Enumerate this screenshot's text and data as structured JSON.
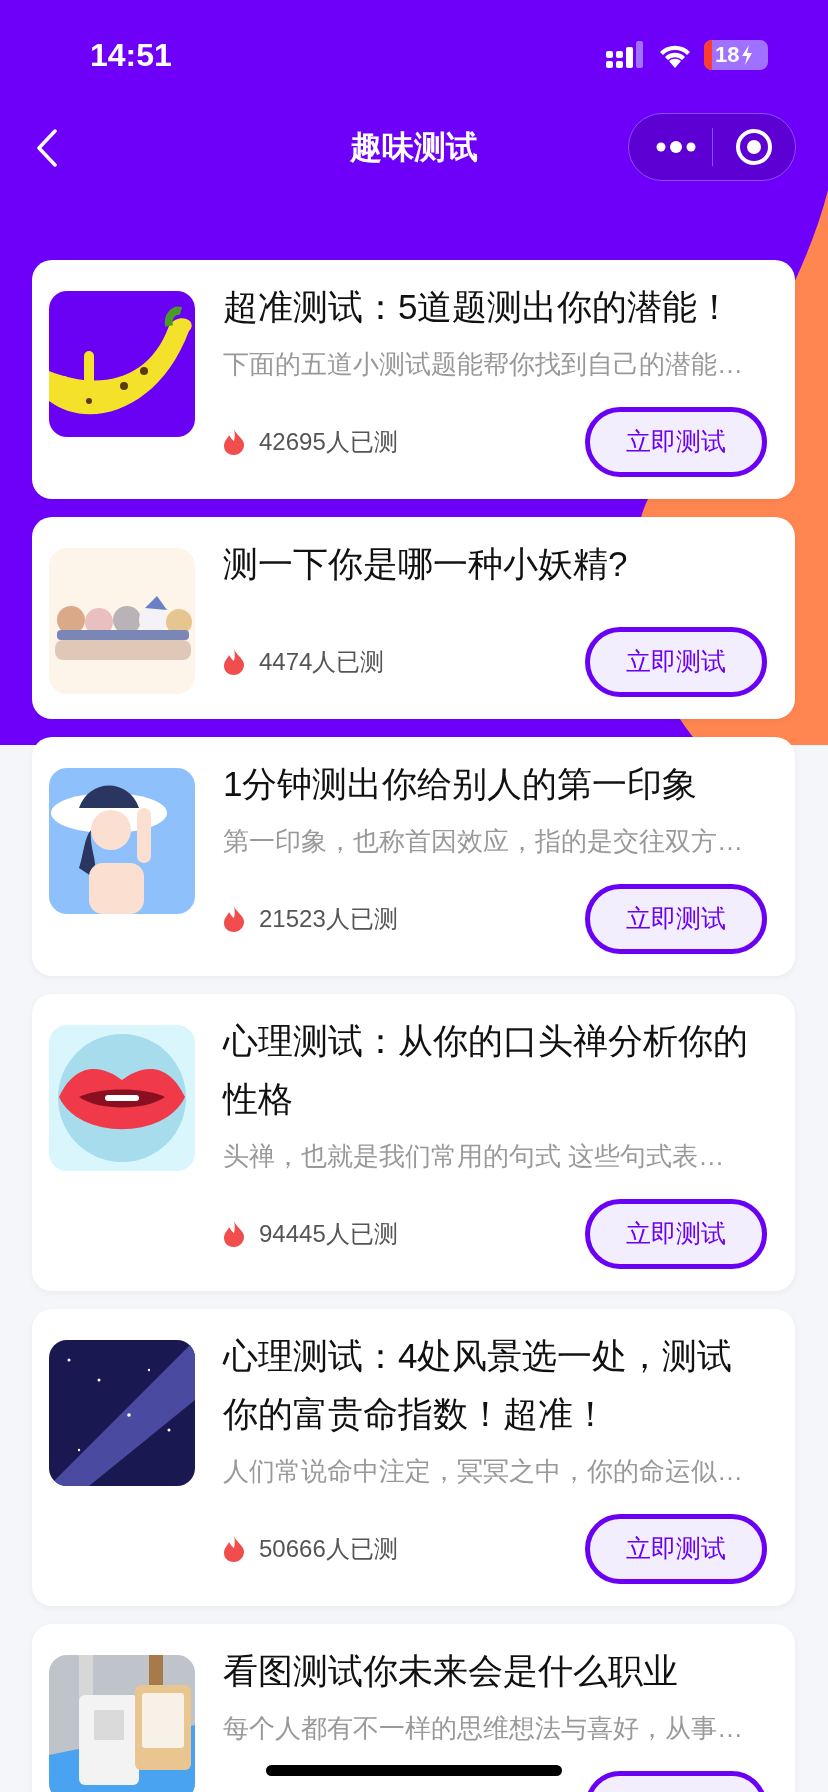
{
  "status_bar": {
    "time": "14:51",
    "battery": "18"
  },
  "nav": {
    "title": "趣味测试"
  },
  "tests": [
    {
      "title": "超准测试：5道题测出你的潜能！",
      "description": "下面的五道小测试题能帮你找到自己的潜能…",
      "count": "42695人已测",
      "button": "立即测试"
    },
    {
      "title": "测一下你是哪一种小妖精?",
      "count": "4474人已测",
      "button": "立即测试"
    },
    {
      "title": "1分钟测出你给别人的第一印象",
      "description": "第一印象，也称首因效应，指的是交往双方…",
      "count": "21523人已测",
      "button": "立即测试"
    },
    {
      "title": "心理测试：从你的口头禅分析你的性格",
      "description": "头禅，也就是我们常用的句式 这些句式表…",
      "count": "94445人已测",
      "button": "立即测试"
    },
    {
      "title": "心理测试：4处风景选一处，测试你的富贵命指数！超准！",
      "description": "人们常说命中注定，冥冥之中，你的命运似…",
      "count": "50666人已测",
      "button": "立即测试"
    },
    {
      "title": "看图测试你未来会是什么职业",
      "description": "每个人都有不一样的思维想法与喜好，从事…"
    }
  ]
}
